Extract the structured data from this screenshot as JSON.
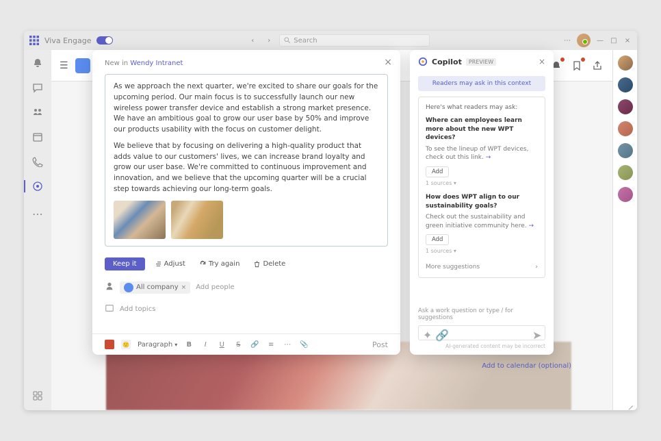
{
  "titlebar": {
    "appname": "Viva Engage",
    "nav_back": "‹",
    "nav_fwd": "›",
    "search_placeholder": "Search",
    "min": "—",
    "max": "□",
    "close": "×"
  },
  "leftrail": {
    "items": [
      {
        "name": "activity",
        "icon": "bell"
      },
      {
        "name": "chat",
        "icon": "chat"
      },
      {
        "name": "teams",
        "icon": "people"
      },
      {
        "name": "calendar",
        "icon": "calendar"
      },
      {
        "name": "calls",
        "icon": "phone"
      },
      {
        "name": "engage",
        "icon": "engage",
        "active": true
      },
      {
        "name": "apps",
        "icon": "apps"
      },
      {
        "name": "more",
        "icon": "dots"
      }
    ]
  },
  "composer": {
    "newin_prefix": "New in",
    "newin_link": "Wendy Intranet",
    "body_p1": "As we approach the next quarter, we're excited to share our goals for the upcoming period. Our main focus is to successfully launch our new wireless power transfer device and establish a strong market presence. We have an ambitious goal to grow our user base by 50% and improve our products usability with the focus on customer delight.",
    "body_p2": "We believe that by focusing on delivering a high-quality product that adds value to our customers' lives, we can increase brand loyalty and grow our user base. We're committed to continuous improvement and innovation, and we believe that the upcoming quarter will be a crucial step towards achieving our long-term goals.",
    "btn_keep": "Keep it",
    "btn_adjust": "Adjust",
    "btn_tryagain": "Try again",
    "btn_delete": "Delete",
    "people_chip": "All company",
    "add_people": "Add people",
    "add_topics": "Add topics",
    "toolbar": {
      "style": "Paragraph",
      "bold": "B",
      "italic": "I",
      "underline": "U",
      "strike": "S",
      "link": "🔗",
      "list": "≡",
      "more": "⋯",
      "post": "Post"
    }
  },
  "copilot": {
    "title": "Copilot",
    "badge": "PREVIEW",
    "notice": "Readers may ask in this context",
    "card_header": "Here's what readers may ask:",
    "sug1_q": "Where can employees learn more about the new WPT devices?",
    "sug1_a": "To see the lineup of WPT devices, check out this link.",
    "sug2_q": "How does WPT align to our sustainability goals?",
    "sug2_a": "Check out the sustainability and green initiative community here.",
    "add": "Add",
    "sources": "1 sources ▾",
    "more": "More suggestions",
    "prompt_placeholder": "Ask a work question or type / for suggestions",
    "legal": "AI-generated content may be incorrect"
  },
  "bg": {
    "calendar_link": "Add to calendar (optional)"
  }
}
